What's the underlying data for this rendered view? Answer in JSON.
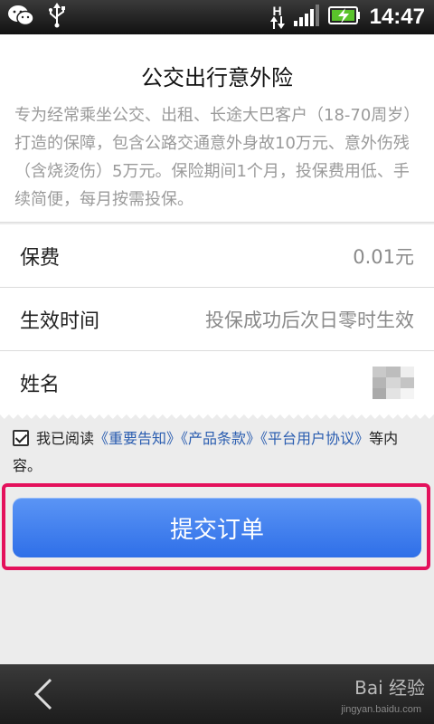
{
  "statusbar": {
    "time": "14:47",
    "network_letter": "H",
    "icons": [
      "wechat-icon",
      "usb-icon",
      "network-arrows-icon",
      "signal-icon",
      "battery-charging-icon"
    ]
  },
  "intro": {
    "title": "公交出行意外险",
    "description": "专为经常乘坐公交、出租、长途大巴客户（18-70周岁）打造的保障，包含公路交通意外身故10万元、意外伤残（含烧烫伤）5万元。保险期间1个月，投保费用低、手续简便，每月按需投保。"
  },
  "rows": {
    "premium": {
      "label": "保费",
      "value": "0.01元"
    },
    "effective": {
      "label": "生效时间",
      "value": "投保成功后次日零时生效"
    },
    "name": {
      "label": "姓名"
    }
  },
  "agreement": {
    "prefix": "我已阅读",
    "link1": "《重要告知》",
    "link2": "《产品条款》",
    "link3": "《平台用户协议》",
    "suffix": "等内容。",
    "checked": true
  },
  "submit": {
    "label": "提交订单"
  },
  "navbar": {
    "watermark": "Bai 经验",
    "watermark_sub": "jingyan.baidu.com"
  },
  "colors": {
    "accent": "#2f6fe8",
    "highlight": "#e4115c",
    "link": "#2a5db0"
  }
}
